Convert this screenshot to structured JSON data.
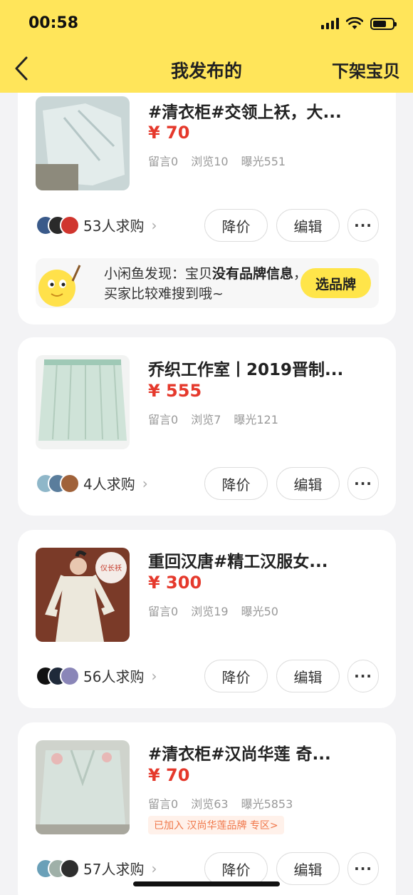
{
  "status_bar": {
    "time": "00:58"
  },
  "header": {
    "title": "我发布的",
    "action_label": "下架宝贝",
    "back_icon": "chevron-left-icon"
  },
  "colors": {
    "header_bg": "#ffe55a",
    "price": "#e5392c",
    "accent_button": "#ffe54a"
  },
  "listings": [
    {
      "title": "#清衣柜#交领上袄，大...",
      "price": "¥ 70",
      "stats": {
        "comments": "留言0",
        "views": "浏览10",
        "exposure": "曝光551"
      },
      "buyers": "53人求购",
      "actions": {
        "price_cut": "降价",
        "edit": "编辑",
        "more": "···"
      },
      "banner": {
        "prefix": "小闲鱼发现：宝贝",
        "bold": "没有品牌信息",
        "suffix": "，买家比较难搜到哦~",
        "button": "选品牌"
      }
    },
    {
      "title": "乔织工作室丨2019晋制...",
      "price": "¥ 555",
      "stats": {
        "comments": "留言0",
        "views": "浏览7",
        "exposure": "曝光121"
      },
      "buyers": "4人求购",
      "actions": {
        "price_cut": "降价",
        "edit": "编辑",
        "more": "···"
      }
    },
    {
      "title": "重回汉唐#精工汉服女...",
      "price": "¥ 300",
      "stats": {
        "comments": "留言0",
        "views": "浏览19",
        "exposure": "曝光50"
      },
      "buyers": "56人求购",
      "image_badge": "仪长袄",
      "actions": {
        "price_cut": "降价",
        "edit": "编辑",
        "more": "···"
      }
    },
    {
      "title": "#清衣柜#汉尚华莲 奇...",
      "price": "¥ 70",
      "stats": {
        "comments": "留言0",
        "views": "浏览63",
        "exposure": "曝光5853"
      },
      "tag": "已加入 汉尚华莲品牌 专区>",
      "buyers": "57人求购",
      "actions": {
        "price_cut": "降价",
        "edit": "编辑",
        "more": "···"
      }
    }
  ]
}
